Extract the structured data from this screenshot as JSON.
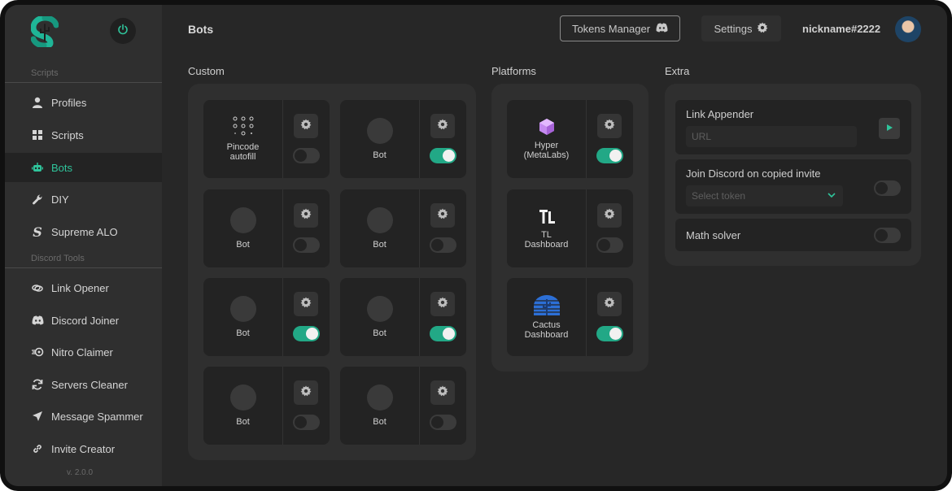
{
  "sidebar": {
    "sections": {
      "scripts": "Scripts",
      "discord_tools": "Discord Tools"
    },
    "items": [
      {
        "label": "Profiles",
        "icon": "user-icon"
      },
      {
        "label": "Scripts",
        "icon": "grid-icon"
      },
      {
        "label": "Bots",
        "icon": "robot-icon",
        "active": true
      },
      {
        "label": "DIY",
        "icon": "wrench-icon"
      },
      {
        "label": "Supreme ALO",
        "icon": "supreme-s-icon"
      },
      {
        "label": "Link Opener",
        "icon": "link-rings-icon"
      },
      {
        "label": "Discord Joiner",
        "icon": "discord-icon"
      },
      {
        "label": "Nitro Claimer",
        "icon": "nitro-icon"
      },
      {
        "label": "Servers Cleaner",
        "icon": "refresh-icon"
      },
      {
        "label": "Message Spammer",
        "icon": "send-icon"
      },
      {
        "label": "Invite Creator",
        "icon": "link-icon"
      }
    ],
    "version": "v. 2.0.0"
  },
  "header": {
    "title": "Bots",
    "tokens_manager": "Tokens Manager",
    "settings": "Settings",
    "username": "nickname#2222"
  },
  "columns": {
    "custom": "Custom",
    "platforms": "Platforms",
    "extra": "Extra"
  },
  "custom_bots": [
    {
      "line1": "Pincode",
      "line2": "autofill",
      "on": false
    },
    {
      "line1": "Bot",
      "line2": "",
      "on": true
    },
    {
      "line1": "Bot",
      "line2": "",
      "on": false
    },
    {
      "line1": "Bot",
      "line2": "",
      "on": false
    },
    {
      "line1": "Bot",
      "line2": "",
      "on": true
    },
    {
      "line1": "Bot",
      "line2": "",
      "on": true
    },
    {
      "line1": "Bot",
      "line2": "",
      "on": false
    },
    {
      "line1": "Bot",
      "line2": "",
      "on": false
    }
  ],
  "platforms": [
    {
      "line1": "Hyper",
      "line2": "(MetaLabs)",
      "icon": "hyper-cube-icon",
      "on": true
    },
    {
      "line1": "TL",
      "line2": "Dashboard",
      "icon": "tl-logo-icon",
      "on": false
    },
    {
      "line1": "Cactus",
      "line2": "Dashboard",
      "icon": "cactus-logo-icon",
      "on": true
    }
  ],
  "extra": {
    "link_appender": {
      "title": "Link Appender",
      "placeholder": "URL"
    },
    "join_discord": {
      "title": "Join Discord on copied invite",
      "select_placeholder": "Select token",
      "on": false
    },
    "math_solver": {
      "title": "Math solver",
      "on": false
    }
  },
  "colors": {
    "accent": "#22a886",
    "background": "#272727",
    "sidebar": "#2f2f2f",
    "card": "#232323"
  }
}
